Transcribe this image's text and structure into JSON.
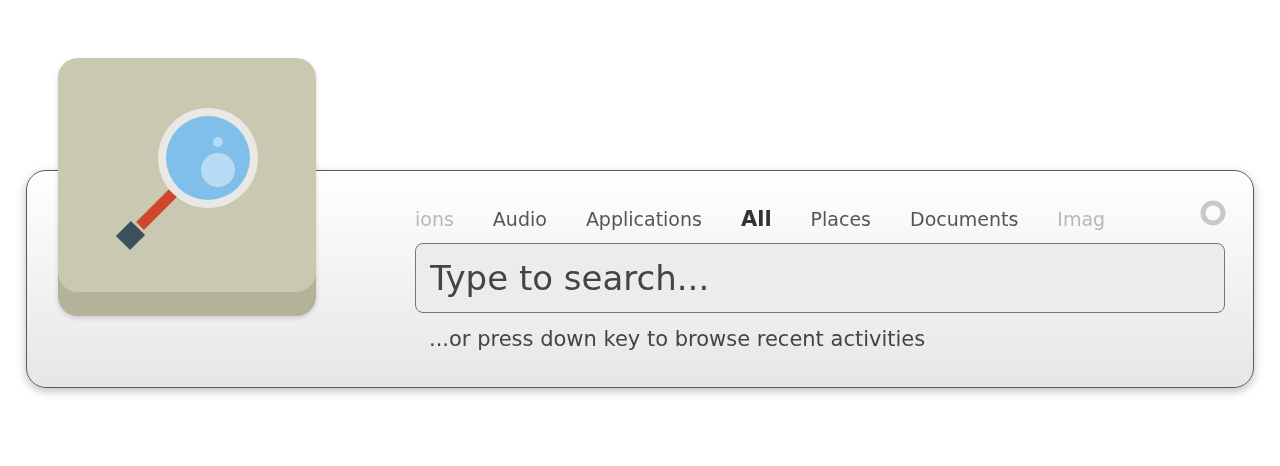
{
  "tabs": [
    {
      "label": "ions",
      "selected": false,
      "faded": true
    },
    {
      "label": "Audio",
      "selected": false,
      "faded": false
    },
    {
      "label": "Applications",
      "selected": false,
      "faded": false
    },
    {
      "label": "All",
      "selected": true,
      "faded": false
    },
    {
      "label": "Places",
      "selected": false,
      "faded": false
    },
    {
      "label": "Documents",
      "selected": false,
      "faded": false
    },
    {
      "label": "Imag",
      "selected": false,
      "faded": true
    }
  ],
  "search": {
    "placeholder": "Type to search..."
  },
  "hint": "...or press down key to browse recent activities"
}
